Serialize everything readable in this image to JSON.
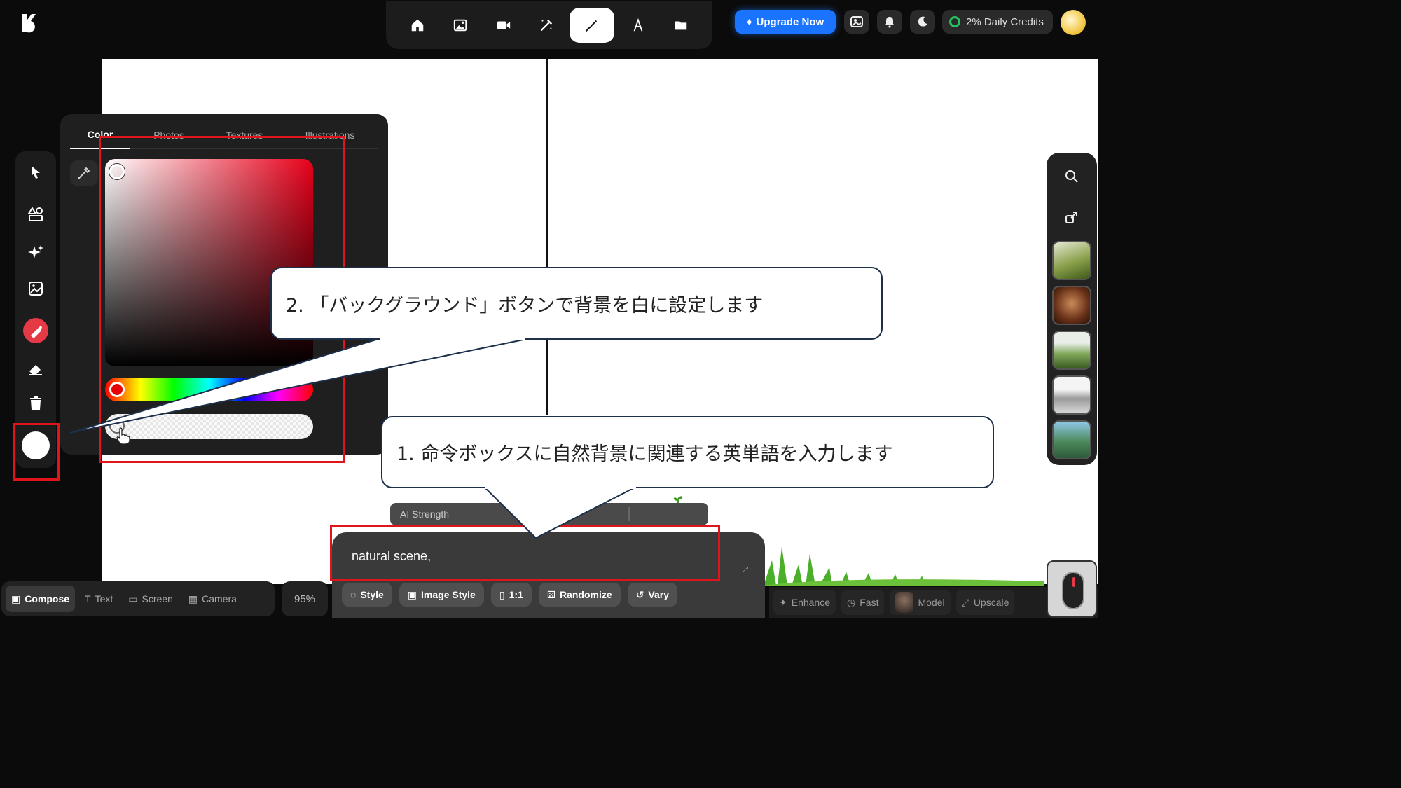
{
  "nav": {
    "items": [
      "home",
      "image",
      "video",
      "edit",
      "draw",
      "text",
      "folder"
    ],
    "active": "draw"
  },
  "header": {
    "upgrade_label": "Upgrade Now",
    "credits_label": "2% Daily Credits"
  },
  "color_panel": {
    "tabs": [
      "Color",
      "Photos",
      "Textures",
      "Illustrations"
    ],
    "active_tab": "Color",
    "hue_color": "#e8001a",
    "selected_color": "#ffffff"
  },
  "prompt": {
    "ai_strength_label": "AI Strength",
    "text": "natural scene,",
    "buttons": [
      "Style",
      "Image Style",
      "1:1",
      "Randomize",
      "Vary"
    ]
  },
  "bottom_left": {
    "items": [
      "Compose",
      "Text",
      "Screen",
      "Camera"
    ],
    "active": "Compose",
    "zoom": "95%"
  },
  "bottom_right": {
    "items": [
      "Enhance",
      "Fast",
      "Model",
      "Upscale"
    ]
  },
  "callouts": {
    "step2": "2. 「バックグラウンド」ボタンで背景を白に設定します",
    "step1": "1. 命令ボックスに自然背景に関連する英単語を入力します"
  },
  "colors": {
    "accent": "#1a74ff",
    "highlight": "#e0151b",
    "credits_ring": "#22c55e"
  }
}
